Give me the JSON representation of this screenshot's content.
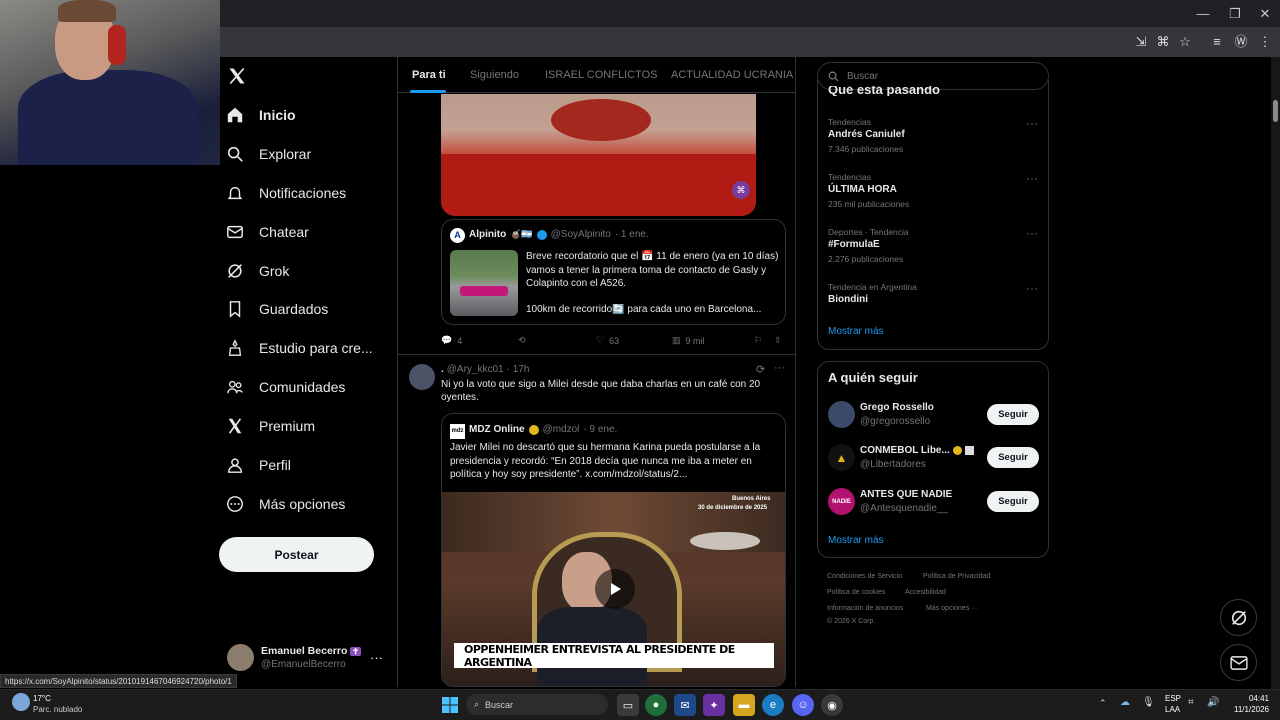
{
  "browser": {
    "status_url": "https://x.com/SoyAlpinito/status/2010191467046924720/photo/1"
  },
  "sidebar": {
    "items": [
      {
        "label": "Inicio",
        "icon": "home-icon"
      },
      {
        "label": "Explorar",
        "icon": "search-icon"
      },
      {
        "label": "Notificaciones",
        "icon": "bell-icon"
      },
      {
        "label": "Chatear",
        "icon": "mail-icon"
      },
      {
        "label": "Grok",
        "icon": "grok-icon"
      },
      {
        "label": "Guardados",
        "icon": "bookmark-icon"
      },
      {
        "label": "Estudio para cre...",
        "icon": "creator-studio-icon"
      },
      {
        "label": "Comunidades",
        "icon": "communities-icon"
      },
      {
        "label": "Premium",
        "icon": "x-premium-icon"
      },
      {
        "label": "Perfil",
        "icon": "profile-icon"
      },
      {
        "label": "Más opciones",
        "icon": "more-icon"
      }
    ],
    "post_button": "Postear",
    "account": {
      "name": "Emanuel Becerro",
      "handle": "@EmanuelBecerro"
    }
  },
  "feed": {
    "tabs": [
      "Para ti",
      "Siguiendo",
      "ISRAEL CONFLICTOS",
      "ACTUALIDAD UCRANIA"
    ],
    "post1": {
      "quote": {
        "name": "Alpinito",
        "handle": "@SoyAlpinito",
        "time": "· 1 ene.",
        "text1": "Breve recordatorio que el 📅 11 de enero (ya en 10 días) vamos a tener la primera toma de contacto de Gasly y Colapinto con el A526.",
        "text2": "100km de recorrido🔄 para cada uno en Barcelona..."
      },
      "actions": {
        "replies": "4",
        "likes": "63",
        "views": "9 mil"
      }
    },
    "post2": {
      "name": ".",
      "handle": "@Ary_kkc01",
      "time": "· 17h",
      "text": "Ni yo la voto que sigo a Milei desde que daba charlas en un café con 20 oyentes.",
      "quote": {
        "name": "MDZ Online",
        "logo": "mdz",
        "handle": "@mdzol",
        "time": "· 9 ene.",
        "text": "Javier Milei no descartó que su hermana Karina pueda postularse a la presidencia y recordó: “En 2018 decía que nunca me iba a meter en política y hoy soy presidente”.  x.com/mdzol/status/2...",
        "video_location": "Buenos Aires",
        "video_date": "30 de diciembre de 2025",
        "video_caption": "OPPENHEIMER ENTREVISTA AL PRESIDENTE DE ARGENTINA"
      }
    }
  },
  "right": {
    "search_placeholder": "Buscar",
    "trends_title": "Qué está pasando",
    "trends": [
      {
        "category": "Tendencias",
        "name": "Andrés Caniulef",
        "count": "7.346 publicaciones"
      },
      {
        "category": "Tendencias",
        "name": "ÚLTIMA HORA",
        "count": "235 mil publicaciones"
      },
      {
        "category": "Deportes · Tendencia",
        "name": "#FormulaE",
        "count": "2.276 publicaciones"
      },
      {
        "category": "Tendencia en Argentina",
        "name": "Biondini",
        "count": ""
      }
    ],
    "show_more": "Mostrar más",
    "follow_title": "A quién seguir",
    "follow": [
      {
        "name": "Grego Rossello",
        "handle": "@gregorossello",
        "button": "Seguir"
      },
      {
        "name": "CONMEBOL Libe...",
        "handle": "@Libertadores",
        "button": "Seguir"
      },
      {
        "name": "ANTES QUE NADIE",
        "handle": "@Antesquenadie__",
        "button": "Seguir",
        "avatar_text": "NADIE"
      }
    ],
    "footer": {
      "l1a": "Condiciones de Servicio",
      "l1b": "Política de Privacidad",
      "l2a": "Política de cookies",
      "l2b": "Accesibilidad",
      "l3a": "Información de anuncios",
      "l3b": "Más opciones ···",
      "l4": "© 2026 X Corp."
    }
  },
  "taskbar": {
    "weather_temp": "17°C",
    "weather_desc": "Parc. nublado",
    "search_placeholder": "Buscar",
    "lang1": "ESP",
    "lang2": "LAA",
    "time": "04:41",
    "date": "11/1/2026"
  },
  "colors": {
    "accent": "#1d9bf0",
    "background": "#000000",
    "border": "#2f3336"
  }
}
